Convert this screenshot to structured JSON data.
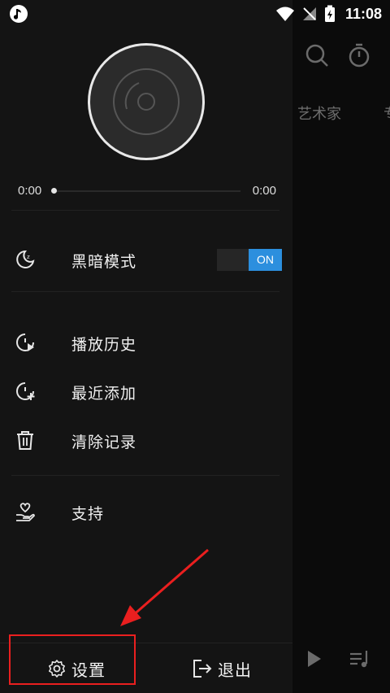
{
  "status_bar": {
    "time": "11:08"
  },
  "background": {
    "tabs": [
      "艺术家",
      "专"
    ],
    "icons": [
      "search-icon",
      "timer-icon",
      "play-icon",
      "playlist-icon"
    ]
  },
  "player": {
    "time_start": "0:00",
    "time_end": "0:00",
    "progress": 0
  },
  "menu": {
    "dark_mode": {
      "label": "黑暗模式",
      "toggle": "ON"
    },
    "history": {
      "label": "播放历史"
    },
    "recent": {
      "label": "最近添加"
    },
    "clear": {
      "label": "清除记录"
    },
    "support": {
      "label": "支持"
    }
  },
  "footer": {
    "settings_label": "设置",
    "exit_label": "退出"
  },
  "colors": {
    "accent": "#2c8fde",
    "annotation": "#ea1f1f",
    "drawer_bg": "#141414"
  }
}
